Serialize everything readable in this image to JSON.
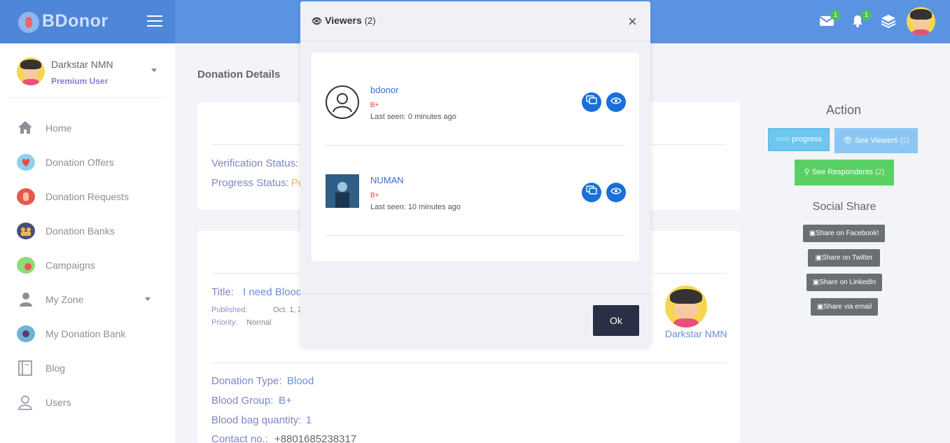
{
  "app": {
    "brand": "BDonor"
  },
  "header": {
    "mail_badge": "1",
    "bell_badge": "1"
  },
  "sidebar": {
    "user_name": "Darkstar NMN",
    "user_role": "Premium User",
    "items": [
      {
        "label": "Home",
        "icon": "home-icon"
      },
      {
        "label": "Donation Offers",
        "icon": "heart-hand-icon"
      },
      {
        "label": "Donation Requests",
        "icon": "hand-blood-icon"
      },
      {
        "label": "Donation Banks",
        "icon": "people-icon"
      },
      {
        "label": "Campaigns",
        "icon": "campaign-icon"
      },
      {
        "label": "My Zone",
        "icon": "user-icon"
      },
      {
        "label": "My Donation Bank",
        "icon": "bank-icon"
      },
      {
        "label": "Blog",
        "icon": "book-icon"
      },
      {
        "label": "Users",
        "icon": "users-icon"
      }
    ]
  },
  "main": {
    "page_title": "Donation Details",
    "status": {
      "verification_label": "Verification Status:",
      "progress_label": "Progress Status:",
      "progress_value_partial": "Pe"
    },
    "post": {
      "title_label": "Title:",
      "title_value": "I need Blood",
      "published_label": "Published:",
      "published_value": "Oct. 1, 2019, 2",
      "priority_label": "Priority:",
      "priority_value": "Normal",
      "author": "Darkstar NMN"
    },
    "details": {
      "donation_type_label": "Donation Type:",
      "donation_type_value": "Blood",
      "blood_group_label": "Blood Group:",
      "blood_group_value": "B+",
      "bag_qty_label": "Blood bag quantity:",
      "bag_qty_value": "1",
      "contact_label": "Contact no.:",
      "contact_value": "+8801685238317"
    }
  },
  "right": {
    "action_title": "Action",
    "progress_btn": "○○○ progress",
    "viewers_btn": "See Viewers",
    "viewers_count": "(2)",
    "respondents_btn": "See Respondents",
    "respondents_count": "(2)",
    "social_title": "Social Share",
    "share_facebook": "Share on Facebook!",
    "share_twitter": "Share on Twitter",
    "share_linkedin": "Share on LinkedIn",
    "share_email": "Share via email"
  },
  "modal": {
    "title": "Viewers",
    "count": "(2)",
    "close": "×",
    "ok": "Ok",
    "viewers": [
      {
        "name": "bdonor",
        "blood": "B+",
        "seen": "Last seen: 0 minutes ago"
      },
      {
        "name": "NUMAN",
        "blood": "B+",
        "seen": "Last seen: 10 minutes ago"
      }
    ]
  }
}
